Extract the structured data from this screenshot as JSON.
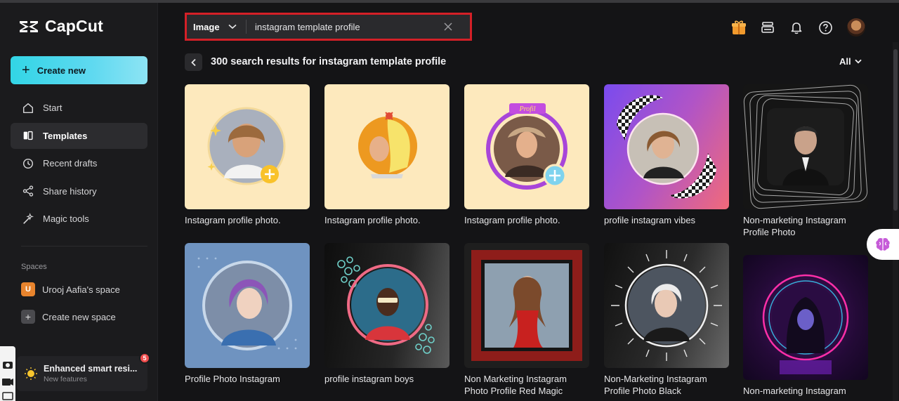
{
  "app": {
    "name": "CapCut"
  },
  "sidebar": {
    "create_label": "Create new",
    "items": [
      {
        "label": "Start",
        "icon": "home-icon"
      },
      {
        "label": "Templates",
        "icon": "templates-icon",
        "active": true
      },
      {
        "label": "Recent drafts",
        "icon": "clock-icon"
      },
      {
        "label": "Share history",
        "icon": "share-icon"
      },
      {
        "label": "Magic tools",
        "icon": "magic-wand-icon"
      }
    ],
    "spaces_label": "Spaces",
    "spaces": [
      {
        "badge": "U",
        "label": "Urooj Aafia's space"
      },
      {
        "badge": "+",
        "label": "Create new space"
      }
    ],
    "feature": {
      "title": "Enhanced smart resi...",
      "subtitle": "New features",
      "badge": "5"
    }
  },
  "search": {
    "type": "Image",
    "value": "instagram template profile"
  },
  "results": {
    "title": "300 search results for instagram template profile",
    "filter": "All"
  },
  "templates": [
    {
      "title": "Instagram profile photo."
    },
    {
      "title": "Instagram profile photo."
    },
    {
      "title": "Instagram profile photo.",
      "ribbon": "Profil"
    },
    {
      "title": "profile instagram vibes"
    },
    {
      "title": "Non-marketing Instagram Profile Photo"
    },
    {
      "title": "Profile Photo Instagram"
    },
    {
      "title": "profile instagram boys"
    },
    {
      "title": "Non Marketing Instagram Photo Profile Red Magic"
    },
    {
      "title": "Non-Marketing Instagram Profile Photo Black"
    },
    {
      "title": "Non-marketing Instagram"
    }
  ],
  "colors": {
    "accent": "#32d5e6",
    "search_highlight": "#d42027",
    "badge": "#ef4d4d"
  }
}
